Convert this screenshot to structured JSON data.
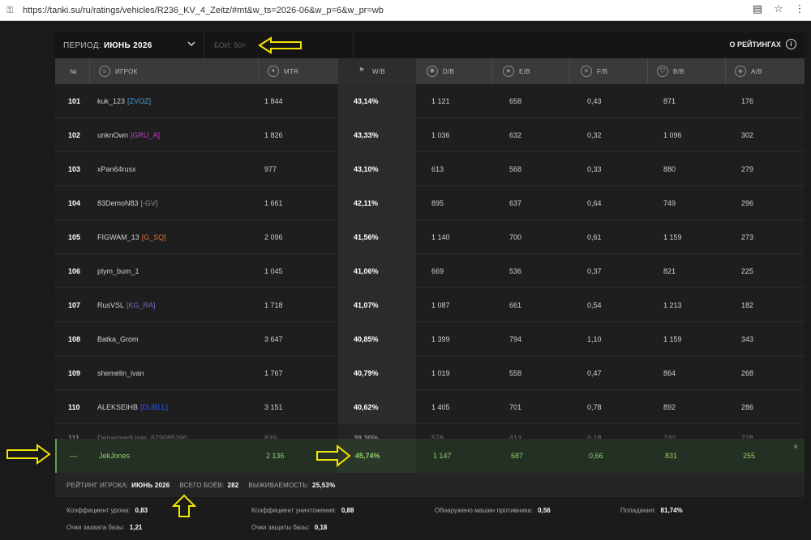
{
  "browser": {
    "url": "https://tanki.su/ru/ratings/vehicles/R236_KV_4_Zeitz/#mt&w_ts=2026-06&w_p=6&w_pr=wb",
    "icons": [
      "reader-icon",
      "star-icon",
      "menu-icon"
    ]
  },
  "filters": {
    "period_label": "ПЕРИОД:",
    "period_value": "ИЮНЬ 2026",
    "battles_placeholder": "БОИ: 50+",
    "about_label": "О РЕЙТИНГАХ"
  },
  "columns": [
    "№",
    "ИГРОК",
    "MTR",
    "W/B",
    "D/B",
    "E/B",
    "F/B",
    "B/B",
    "A/B"
  ],
  "rows": [
    {
      "rank": "101",
      "player": "kuk_123",
      "clan": "[ZVOZ]",
      "clan_color": "#4aa0d8",
      "mtr": "1 844",
      "wb": "43,14%",
      "db": "1 121",
      "eb": "658",
      "fb": "0,43",
      "bb": "871",
      "ab": "176"
    },
    {
      "rank": "102",
      "player": "unknOwn",
      "clan": "[GRU_A]",
      "clan_color": "#c040c8",
      "mtr": "1 826",
      "wb": "43,33%",
      "db": "1 036",
      "eb": "632",
      "fb": "0,32",
      "bb": "1 096",
      "ab": "302"
    },
    {
      "rank": "103",
      "player": "xPan64rusx",
      "clan": "",
      "clan_color": "#cfcfcf",
      "mtr": "977",
      "wb": "43,10%",
      "db": "613",
      "eb": "568",
      "fb": "0,33",
      "bb": "880",
      "ab": "279"
    },
    {
      "rank": "104",
      "player": "83DemoN83",
      "clan": "[-GV]",
      "clan_color": "#8a8a8a",
      "mtr": "1 661",
      "wb": "42,11%",
      "db": "895",
      "eb": "637",
      "fb": "0,64",
      "bb": "749",
      "ab": "296"
    },
    {
      "rank": "105",
      "player": "FIGWAM_13",
      "clan": "[G_SQ]",
      "clan_color": "#e07030",
      "mtr": "2 096",
      "wb": "41,56%",
      "db": "1 140",
      "eb": "700",
      "fb": "0,61",
      "bb": "1 159",
      "ab": "273"
    },
    {
      "rank": "106",
      "player": "plym_bum_1",
      "clan": "",
      "clan_color": "#cfcfcf",
      "mtr": "1 045",
      "wb": "41,06%",
      "db": "669",
      "eb": "536",
      "fb": "0,37",
      "bb": "821",
      "ab": "225"
    },
    {
      "rank": "107",
      "player": "RusVSL",
      "clan": "[KG_RA]",
      "clan_color": "#7a6ac8",
      "mtr": "1 718",
      "wb": "41,07%",
      "db": "1 087",
      "eb": "661",
      "fb": "0,54",
      "bb": "1 213",
      "ab": "182"
    },
    {
      "rank": "108",
      "player": "Batka_Grom",
      "clan": "",
      "clan_color": "#cfcfcf",
      "mtr": "3 647",
      "wb": "40,85%",
      "db": "1 399",
      "eb": "794",
      "fb": "1,10",
      "bb": "1 159",
      "ab": "343"
    },
    {
      "rank": "109",
      "player": "shemelin_ivan",
      "clan": "",
      "clan_color": "#cfcfcf",
      "mtr": "1 767",
      "wb": "40,79%",
      "db": "1 019",
      "eb": "558",
      "fb": "0,47",
      "bb": "864",
      "ab": "268"
    },
    {
      "rank": "110",
      "player": "ALEKSEIHB",
      "clan": "[DUBLL]",
      "clan_color": "#3050e0",
      "mtr": "3 151",
      "wb": "40,62%",
      "db": "1 405",
      "eb": "701",
      "fb": "0,78",
      "bb": "892",
      "ab": "286"
    },
    {
      "rank": "111",
      "player": "DeparmedUser_679085390",
      "clan": "",
      "clan_color": "#cfcfcf",
      "mtr": "839",
      "wb": "39,30%",
      "db": "578",
      "eb": "413",
      "fb": "0,18",
      "bb": "740",
      "ab": "228"
    }
  ],
  "user_row": {
    "rank": "—",
    "player": "JekJones",
    "mtr": "2 136",
    "wb": "45,74%",
    "db": "1 147",
    "eb": "687",
    "fb": "0,66",
    "bb": "831",
    "ab": "255",
    "close": "×"
  },
  "summary": {
    "rating_label": "РЕЙТИНГ ИГРОКА:",
    "rating_value": "ИЮНЬ 2026",
    "battles_label": "ВСЕГО БОЁВ:",
    "battles_value": "282",
    "survival_label": "ВЫЖИВАЕМОСТЬ:",
    "survival_value": "25,53%"
  },
  "details": {
    "damage_ratio_label": "Коэффициент урона:",
    "damage_ratio_value": "0,83",
    "kill_ratio_label": "Коэффициент уничтожения:",
    "kill_ratio_value": "0,88",
    "spotted_label": "Обнаружено машин противника:",
    "spotted_value": "0,56",
    "hits_label": "Попадания:",
    "hits_value": "81,74%",
    "capture_label": "Очки захвата базы:",
    "capture_value": "1,21",
    "defense_label": "Очки защиты базы:",
    "defense_value": "0,18"
  },
  "colors": {
    "accent_green": "#8fd06a",
    "annotation_arrow": "#f2e600"
  }
}
